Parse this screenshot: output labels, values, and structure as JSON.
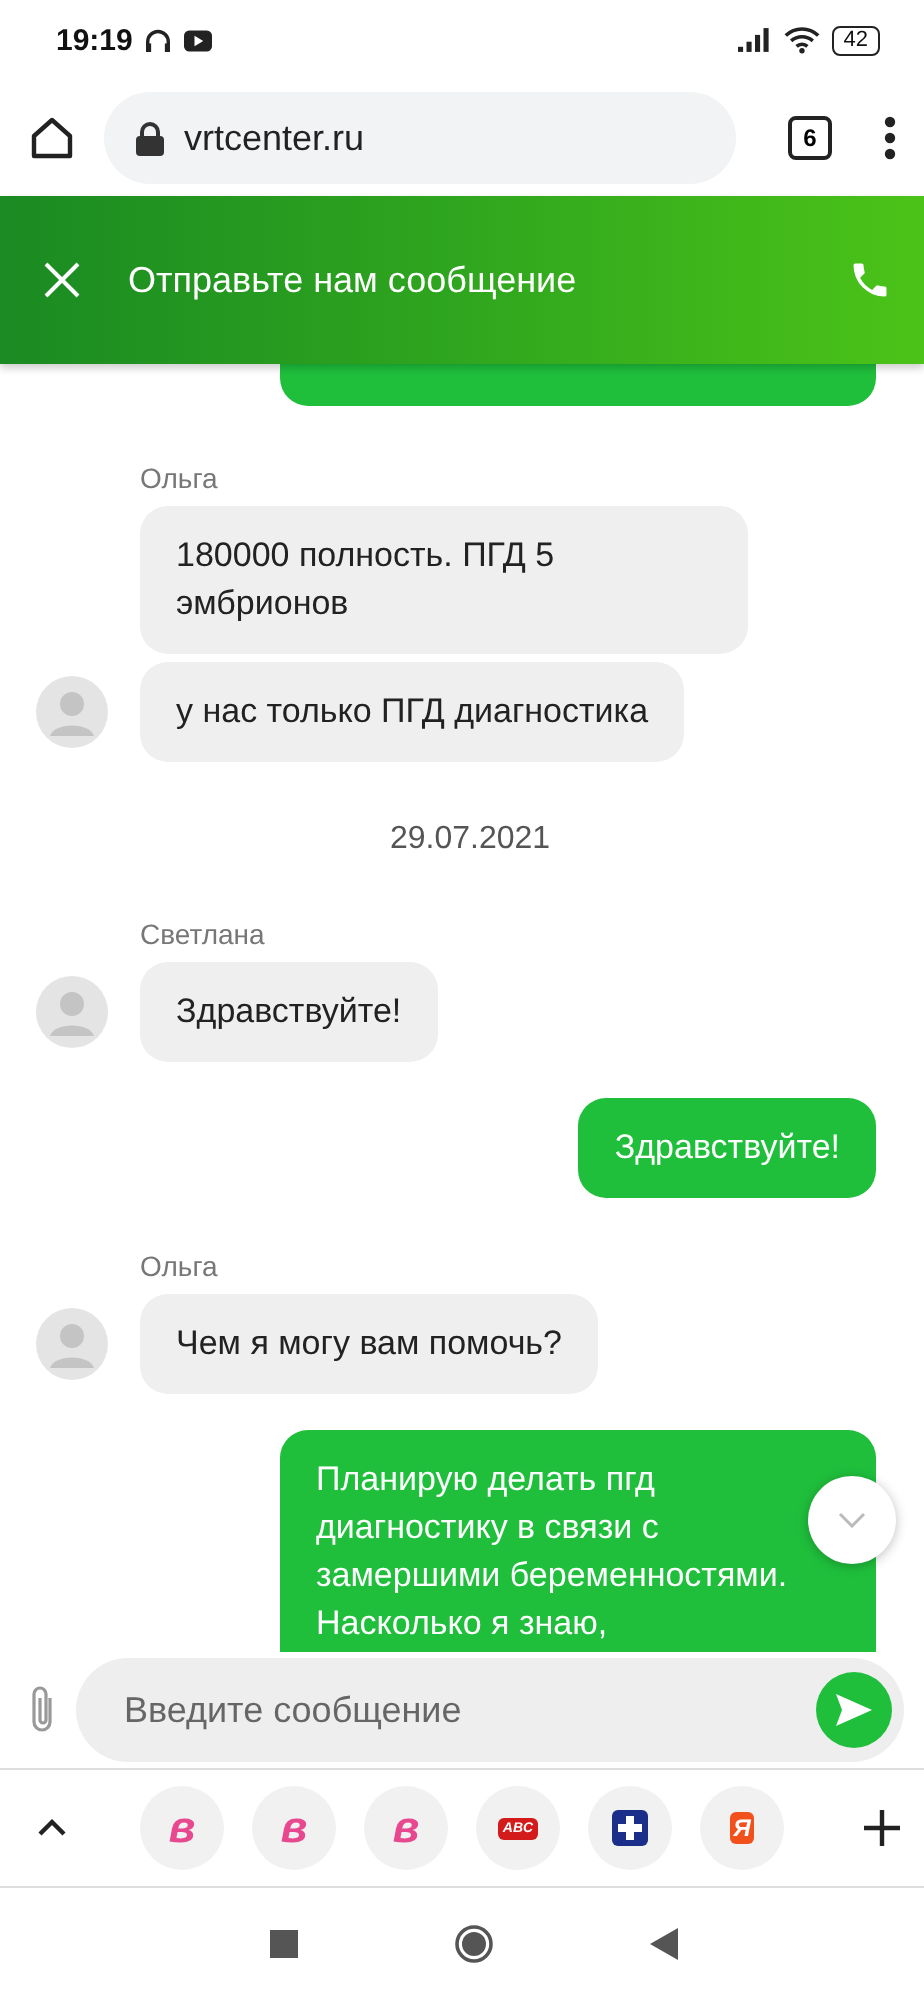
{
  "status_bar": {
    "time": "19:19",
    "battery": "42"
  },
  "browser": {
    "url": "vrtcenter.ru",
    "tab_count": "6"
  },
  "chat_header": {
    "title": "Отправьте нам сообщение"
  },
  "messages": [
    {
      "kind": "outgoing_cut_top"
    },
    {
      "kind": "sender",
      "text": "Ольга"
    },
    {
      "kind": "incoming",
      "text": "180000 полность. ПГД 5 эмбрионов",
      "avatar": false
    },
    {
      "kind": "incoming",
      "text": "у нас только ПГД диагностика",
      "avatar": true
    },
    {
      "kind": "date",
      "text": "29.07.2021"
    },
    {
      "kind": "sender",
      "text": "Светлана"
    },
    {
      "kind": "incoming",
      "text": "Здравствуйте!",
      "avatar": true
    },
    {
      "kind": "outgoing",
      "text": "Здравствуйте!"
    },
    {
      "kind": "sender",
      "text": "Ольга"
    },
    {
      "kind": "incoming",
      "text": "Чем я могу вам помочь?",
      "avatar": true
    },
    {
      "kind": "outgoing",
      "text": "Планирую делать пгд диагностику в связи с замершими беременностями. Насколько я знаю,"
    }
  ],
  "composer": {
    "placeholder": "Введите сообщение"
  },
  "shortcuts": [
    {
      "kind": "letter",
      "label": "в"
    },
    {
      "kind": "letter",
      "label": "в"
    },
    {
      "kind": "letter",
      "label": "в"
    },
    {
      "kind": "red",
      "label": "ABC"
    },
    {
      "kind": "cross"
    },
    {
      "kind": "orange",
      "label": "Я"
    }
  ]
}
